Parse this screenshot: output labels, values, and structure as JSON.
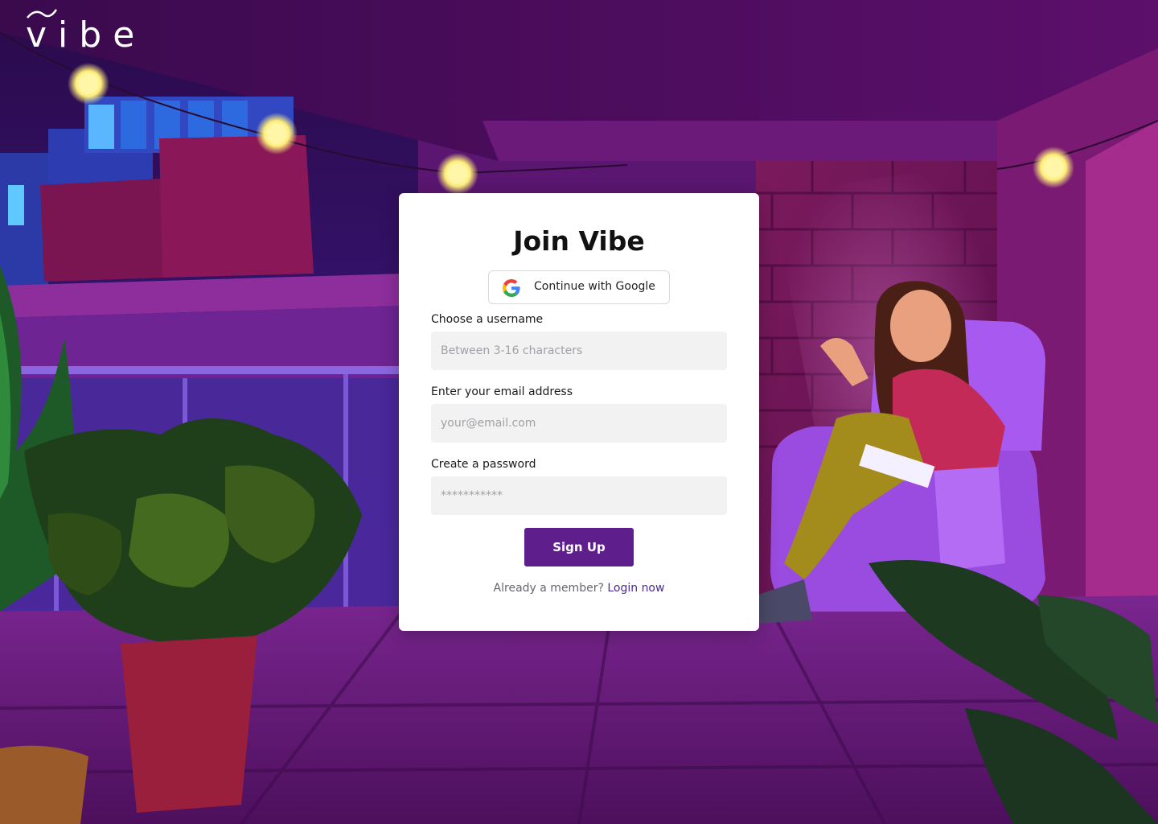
{
  "brand": {
    "logo_text": "vibe"
  },
  "card": {
    "title": "Join Vibe",
    "google_button_label": "Continue with Google",
    "fields": [
      {
        "label": "Choose a username",
        "placeholder": "Between 3-16 characters"
      },
      {
        "label": "Enter your email address",
        "placeholder": "your@email.com"
      },
      {
        "label": "Create a password",
        "placeholder": "***********"
      }
    ],
    "submit_label": "Sign Up",
    "login_prompt": "Already a member?",
    "login_link": "Login now"
  },
  "colors": {
    "accent": "#5e1f8c",
    "link": "#4b2a95",
    "input_bg": "#f2f2f3"
  },
  "icons": [
    "google-icon"
  ]
}
